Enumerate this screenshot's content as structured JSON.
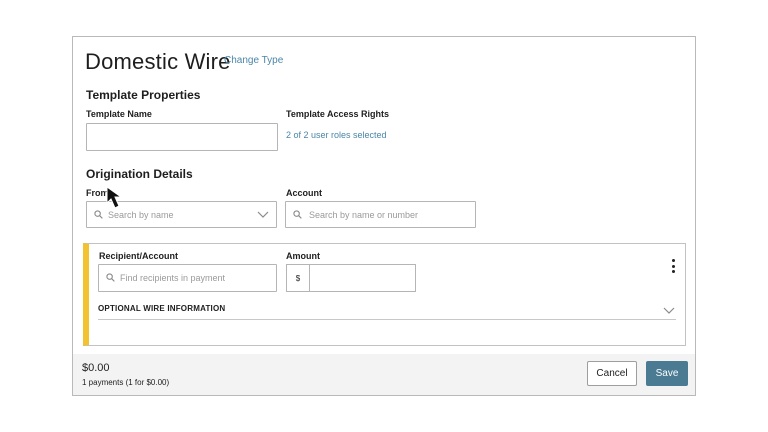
{
  "page": {
    "title": "Domestic Wire",
    "change_type_label": "Change Type"
  },
  "template_properties": {
    "heading": "Template Properties",
    "template_name_label": "Template Name",
    "template_name_value": "",
    "access_rights_label": "Template Access Rights",
    "access_rights_link": "2 of 2 user roles selected"
  },
  "origination": {
    "heading": "Origination Details",
    "from_label": "From",
    "from_placeholder": "Search by name",
    "account_label": "Account",
    "account_placeholder": "Search by name or number"
  },
  "recipient": {
    "recipient_label": "Recipient/Account",
    "recipient_placeholder": "Find recipients in payment",
    "amount_label": "Amount",
    "currency_symbol": "$",
    "amount_value": "",
    "optional_label": "OPTIONAL WIRE INFORMATION"
  },
  "footer": {
    "total": "$0.00",
    "payments_summary": "1 payments (1 for $0.00)",
    "cancel_label": "Cancel",
    "save_label": "Save"
  },
  "colors": {
    "accent_link": "#4a86a8",
    "save_button": "#4a7b93",
    "panel_accent": "#f2c230"
  },
  "icons": [
    "search-icon",
    "chevron-down-icon",
    "kebab-menu-icon",
    "mouse-cursor-icon"
  ]
}
